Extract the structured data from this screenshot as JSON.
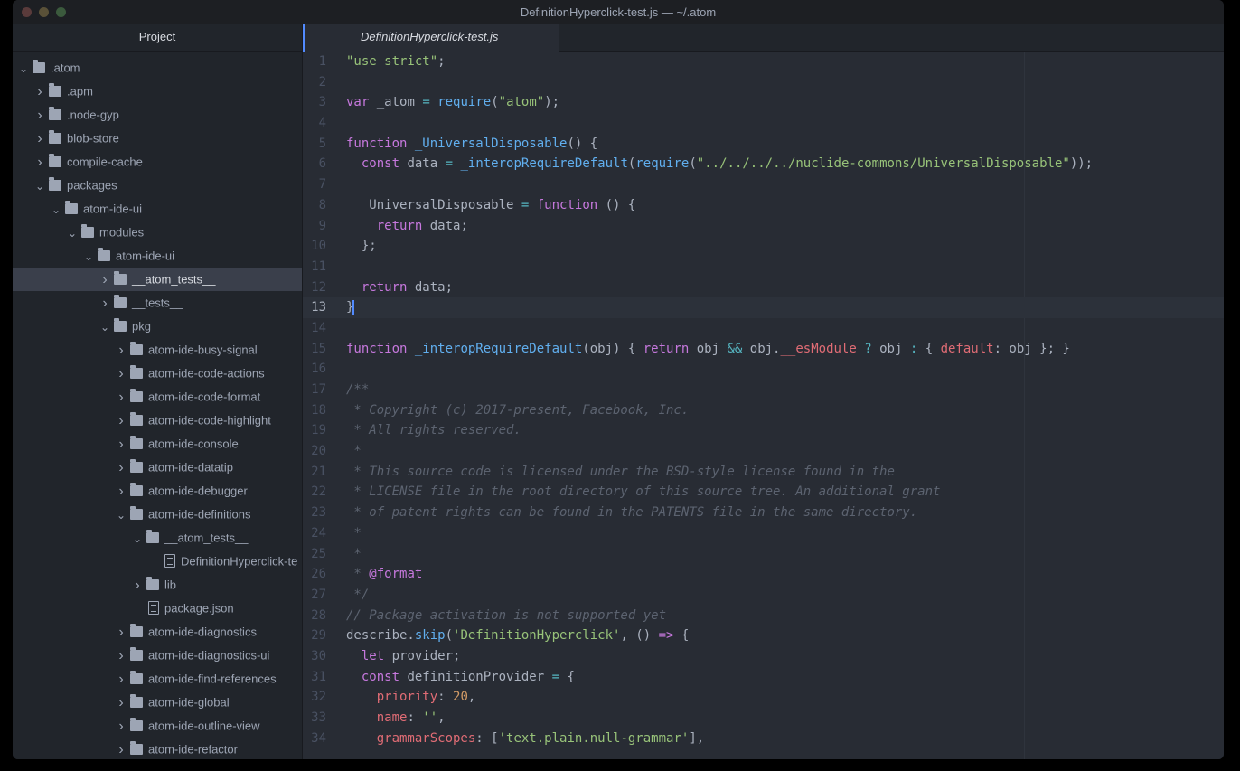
{
  "window": {
    "title": "DefinitionHyperclick-test.js — ~/.atom"
  },
  "tree": {
    "header": "Project",
    "items": [
      {
        "label": ".atom",
        "depth": 0,
        "kind": "folder",
        "open": true
      },
      {
        "label": ".apm",
        "depth": 1,
        "kind": "folder",
        "open": false
      },
      {
        "label": ".node-gyp",
        "depth": 1,
        "kind": "folder",
        "open": false
      },
      {
        "label": "blob-store",
        "depth": 1,
        "kind": "folder",
        "open": false
      },
      {
        "label": "compile-cache",
        "depth": 1,
        "kind": "folder",
        "open": false
      },
      {
        "label": "packages",
        "depth": 1,
        "kind": "folder",
        "open": true
      },
      {
        "label": "atom-ide-ui",
        "depth": 2,
        "kind": "folder",
        "open": true
      },
      {
        "label": "modules",
        "depth": 3,
        "kind": "folder",
        "open": true
      },
      {
        "label": "atom-ide-ui",
        "depth": 4,
        "kind": "folder",
        "open": true
      },
      {
        "label": "__atom_tests__",
        "depth": 5,
        "kind": "folder",
        "open": false,
        "selected": true
      },
      {
        "label": "__tests__",
        "depth": 5,
        "kind": "folder",
        "open": false
      },
      {
        "label": "pkg",
        "depth": 5,
        "kind": "folder",
        "open": true
      },
      {
        "label": "atom-ide-busy-signal",
        "depth": 6,
        "kind": "folder",
        "open": false
      },
      {
        "label": "atom-ide-code-actions",
        "depth": 6,
        "kind": "folder",
        "open": false
      },
      {
        "label": "atom-ide-code-format",
        "depth": 6,
        "kind": "folder",
        "open": false
      },
      {
        "label": "atom-ide-code-highlight",
        "depth": 6,
        "kind": "folder",
        "open": false
      },
      {
        "label": "atom-ide-console",
        "depth": 6,
        "kind": "folder",
        "open": false
      },
      {
        "label": "atom-ide-datatip",
        "depth": 6,
        "kind": "folder",
        "open": false
      },
      {
        "label": "atom-ide-debugger",
        "depth": 6,
        "kind": "folder",
        "open": false
      },
      {
        "label": "atom-ide-definitions",
        "depth": 6,
        "kind": "folder",
        "open": true
      },
      {
        "label": "__atom_tests__",
        "depth": 7,
        "kind": "folder",
        "open": true
      },
      {
        "label": "DefinitionHyperclick-te",
        "depth": 8,
        "kind": "file"
      },
      {
        "label": "lib",
        "depth": 7,
        "kind": "folder",
        "open": false
      },
      {
        "label": "package.json",
        "depth": 7,
        "kind": "file"
      },
      {
        "label": "atom-ide-diagnostics",
        "depth": 6,
        "kind": "folder",
        "open": false
      },
      {
        "label": "atom-ide-diagnostics-ui",
        "depth": 6,
        "kind": "folder",
        "open": false
      },
      {
        "label": "atom-ide-find-references",
        "depth": 6,
        "kind": "folder",
        "open": false
      },
      {
        "label": "atom-ide-global",
        "depth": 6,
        "kind": "folder",
        "open": false
      },
      {
        "label": "atom-ide-outline-view",
        "depth": 6,
        "kind": "folder",
        "open": false
      },
      {
        "label": "atom-ide-refactor",
        "depth": 6,
        "kind": "folder",
        "open": false
      }
    ]
  },
  "editor": {
    "tab_label": "DefinitionHyperclick-test.js",
    "cursor_line": 13,
    "lines": [
      [
        [
          "s",
          "\"use strict\""
        ],
        [
          "p",
          ";"
        ]
      ],
      [],
      [
        [
          "k",
          "var"
        ],
        [
          "p",
          " _atom "
        ],
        [
          "o",
          "="
        ],
        [
          "p",
          " "
        ],
        [
          "f",
          "require"
        ],
        [
          "p",
          "("
        ],
        [
          "s",
          "\"atom\""
        ],
        [
          "p",
          ");"
        ]
      ],
      [],
      [
        [
          "k",
          "function"
        ],
        [
          "p",
          " "
        ],
        [
          "f",
          "_UniversalDisposable"
        ],
        [
          "p",
          "() "
        ],
        [
          "p",
          "{"
        ]
      ],
      [
        [
          "p",
          "  "
        ],
        [
          "k",
          "const"
        ],
        [
          "p",
          " data "
        ],
        [
          "o",
          "="
        ],
        [
          "p",
          " "
        ],
        [
          "f",
          "_interopRequireDefault"
        ],
        [
          "p",
          "("
        ],
        [
          "f",
          "require"
        ],
        [
          "p",
          "("
        ],
        [
          "s",
          "\"../../../../nuclide-commons/UniversalDisposable\""
        ],
        [
          "p",
          "));"
        ]
      ],
      [],
      [
        [
          "p",
          "  _UniversalDisposable "
        ],
        [
          "o",
          "="
        ],
        [
          "p",
          " "
        ],
        [
          "k",
          "function"
        ],
        [
          "p",
          " () {"
        ]
      ],
      [
        [
          "p",
          "    "
        ],
        [
          "k",
          "return"
        ],
        [
          "p",
          " data;"
        ]
      ],
      [
        [
          "p",
          "  };"
        ]
      ],
      [],
      [
        [
          "p",
          "  "
        ],
        [
          "k",
          "return"
        ],
        [
          "p",
          " data;"
        ]
      ],
      [
        [
          "p",
          "}"
        ]
      ],
      [],
      [
        [
          "k",
          "function"
        ],
        [
          "p",
          " "
        ],
        [
          "f",
          "_interopRequireDefault"
        ],
        [
          "p",
          "(obj) { "
        ],
        [
          "k",
          "return"
        ],
        [
          "p",
          " obj "
        ],
        [
          "o",
          "&&"
        ],
        [
          "p",
          " obj."
        ],
        [
          "v",
          "__esModule"
        ],
        [
          "p",
          " "
        ],
        [
          "o",
          "?"
        ],
        [
          "p",
          " obj "
        ],
        [
          "o",
          ":"
        ],
        [
          "p",
          " { "
        ],
        [
          "v",
          "default"
        ],
        [
          "p",
          ": obj }; }"
        ]
      ],
      [],
      [
        [
          "c",
          "/**"
        ]
      ],
      [
        [
          "c",
          " * Copyright (c) 2017-present, Facebook, Inc."
        ]
      ],
      [
        [
          "c",
          " * All rights reserved."
        ]
      ],
      [
        [
          "c",
          " *"
        ]
      ],
      [
        [
          "c",
          " * This source code is licensed under the BSD-style license found in the"
        ]
      ],
      [
        [
          "c",
          " * LICENSE file in the root directory of this source tree. An additional grant"
        ]
      ],
      [
        [
          "c",
          " * of patent rights can be found in the PATENTS file in the same directory."
        ]
      ],
      [
        [
          "c",
          " *"
        ]
      ],
      [
        [
          "c",
          " *"
        ]
      ],
      [
        [
          "c",
          " * "
        ],
        [
          "k",
          "@format"
        ]
      ],
      [
        [
          "c",
          " */"
        ]
      ],
      [
        [
          "c",
          "// Package activation is not supported yet"
        ]
      ],
      [
        [
          "p",
          "describe."
        ],
        [
          "f",
          "skip"
        ],
        [
          "p",
          "("
        ],
        [
          "s",
          "'DefinitionHyperclick'"
        ],
        [
          "p",
          ", () "
        ],
        [
          "k",
          "=>"
        ],
        [
          "p",
          " {"
        ]
      ],
      [
        [
          "p",
          "  "
        ],
        [
          "k",
          "let"
        ],
        [
          "p",
          " provider;"
        ]
      ],
      [
        [
          "p",
          "  "
        ],
        [
          "k",
          "const"
        ],
        [
          "p",
          " definitionProvider "
        ],
        [
          "o",
          "="
        ],
        [
          "p",
          " {"
        ]
      ],
      [
        [
          "p",
          "    "
        ],
        [
          "v",
          "priority"
        ],
        [
          "p",
          ": "
        ],
        [
          "n",
          "20"
        ],
        [
          "p",
          ","
        ]
      ],
      [
        [
          "p",
          "    "
        ],
        [
          "v",
          "name"
        ],
        [
          "p",
          ": "
        ],
        [
          "s",
          "''"
        ],
        [
          "p",
          ","
        ]
      ],
      [
        [
          "p",
          "    "
        ],
        [
          "v",
          "grammarScopes"
        ],
        [
          "p",
          ": ["
        ],
        [
          "s",
          "'text.plain.null-grammar'"
        ],
        [
          "p",
          "],"
        ]
      ]
    ]
  }
}
